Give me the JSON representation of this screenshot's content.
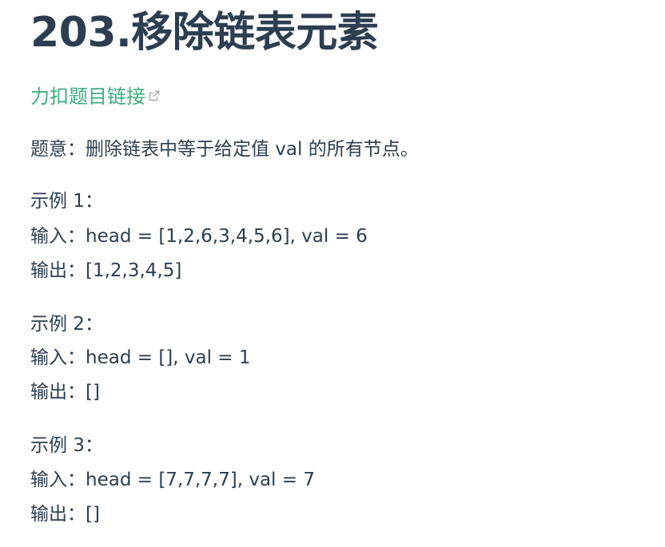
{
  "title": "203.移除链表元素",
  "link": {
    "label": "力扣题目链接",
    "icon": "external-link-icon",
    "color": "#3eaf7c"
  },
  "description": "题意：删除链表中等于给定值 val 的所有节点。",
  "examples": [
    {
      "title": "示例 1：",
      "input": "输入：head = [1,2,6,3,4,5,6], val = 6",
      "output": "输出：[1,2,3,4,5]"
    },
    {
      "title": "示例 2：",
      "input": "输入：head = [], val = 1",
      "output": "输出：[]"
    },
    {
      "title": "示例 3：",
      "input": "输入：head = [7,7,7,7], val = 7",
      "output": "输出：[]"
    }
  ],
  "colors": {
    "text": "#2c3e50",
    "accent": "#3eaf7c",
    "icon": "#aaaaaa"
  }
}
